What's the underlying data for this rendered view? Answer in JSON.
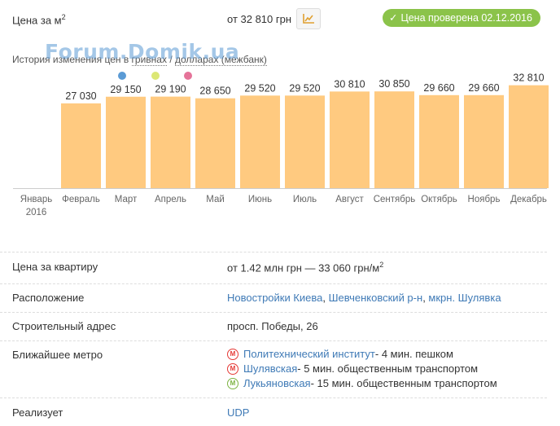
{
  "header": {
    "price_per_m2_label": "Цена за м",
    "price_per_m2_sup": "2",
    "price_value": "от 32 810 грн",
    "verified_text": "Цена проверена 02.12.2016"
  },
  "watermark": "Forum.Domik.ua",
  "history": {
    "prefix": "История изменения цен в ",
    "uah_link": "гривнах",
    "separator": " / ",
    "usd_link": "долларах (межбанк)"
  },
  "chart_data": {
    "type": "bar",
    "categories": [
      "Январь 2016",
      "Февраль",
      "Март",
      "Апрель",
      "Май",
      "Июнь",
      "Июль",
      "Август",
      "Сентябрь",
      "Октябрь",
      "Ноябрь",
      "Декабрь"
    ],
    "values": [
      null,
      27030,
      29150,
      29190,
      28650,
      29520,
      29520,
      30810,
      30850,
      29660,
      29660,
      32810
    ],
    "data_labels": [
      "",
      "27 030",
      "29 150",
      "29 190",
      "28 650",
      "29 520",
      "29 520",
      "30 810",
      "30 850",
      "29 660",
      "29 660",
      "32 810"
    ],
    "bar_color": "#ffca80",
    "ylim": [
      0,
      33500
    ],
    "grid": false,
    "legend_colors": [
      "#5b9bd5",
      "#dce775",
      "#e57399"
    ]
  },
  "details": {
    "apartment_price_label": "Цена за квартиру",
    "apartment_price_value": "от 1.42 млн грн — 33 060 грн/м",
    "apartment_price_sup": "2",
    "location_label": "Расположение",
    "location_link1": "Новостройки Киева",
    "location_sep1": ", ",
    "location_link2": "Шевченковский р-н",
    "location_sep2": ", ",
    "location_link3": "мкрн. Шулявка",
    "address_label": "Строительный адрес",
    "address_value": "просп. Победы, 26",
    "metro_label": "Ближайшее метро",
    "metro": [
      {
        "name": "Политехнический институт",
        "rest": " - 4 мин. пешком",
        "line_color": "#e53935",
        "icon": "metro-icon"
      },
      {
        "name": "Шулявская",
        "rest": " - 5 мин. общественным транспортом",
        "line_color": "#e53935",
        "icon": "metro-icon"
      },
      {
        "name": "Лукьяновская",
        "rest": " - 15 мин. общественным транспортом",
        "line_color": "#7cb342",
        "icon": "metro-icon"
      }
    ],
    "seller_label": "Реализует",
    "seller_value": "UDP"
  },
  "icons": {
    "chart_button": "line-chart-icon",
    "verified": "check-icon",
    "metro_glyph": "M"
  }
}
